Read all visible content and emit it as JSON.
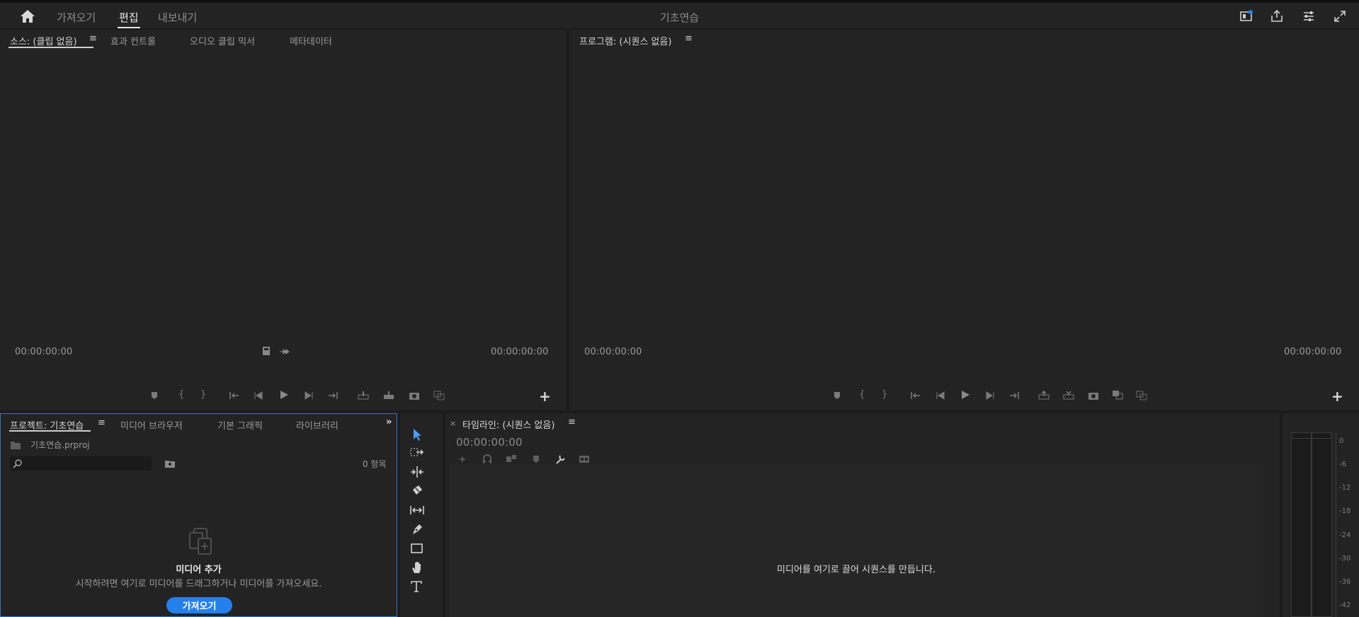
{
  "topbar": {
    "tabs": [
      "가져오기",
      "편집",
      "내보내기"
    ],
    "active_tab": "편집",
    "project_title": "기초연습"
  },
  "source_panel": {
    "tabs": [
      "소스: (클립 없음)",
      "효과 컨트롤",
      "오디오 클립 믹서",
      "메타데이터"
    ],
    "timecode_in": "00:00:00:00",
    "timecode_out": "00:00:00:00"
  },
  "program_panel": {
    "tab": "프로그램: (시퀀스 없음)",
    "timecode_in": "00:00:00:00",
    "timecode_out": "00:00:00:00"
  },
  "project_panel": {
    "tabs": [
      "프로젝트: 기초연습",
      "미디어 브라우저",
      "기본 그래픽",
      "라이브러리"
    ],
    "file_name": "기초연습.prproj",
    "search_placeholder": "",
    "item_count": "0 항목",
    "empty_title": "미디어 추가",
    "empty_desc": "시작하려면 여기로 미디어를 드래그하거나 미디어를 가져오세요.",
    "import_button": "가져오기"
  },
  "timeline_panel": {
    "tab": "타임라인: (시퀀스 없음)",
    "timecode": "00:00:00:00",
    "drop_hint": "미디어를 여기로 끌어 시퀀스를 만듭니다."
  },
  "audio_meter": {
    "scale": [
      "0",
      "-6",
      "-12",
      "-18",
      "-24",
      "-30",
      "-36",
      "-42"
    ]
  },
  "colors": {
    "accent": "#2680eb",
    "panel_bg": "#232323",
    "border_active": "#3a73b8"
  }
}
